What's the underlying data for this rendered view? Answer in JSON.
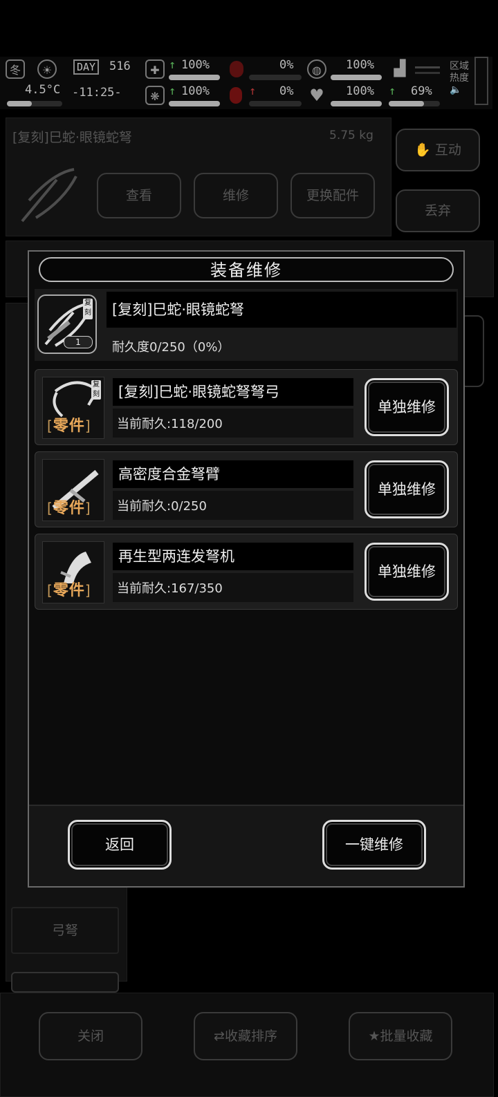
{
  "hud": {
    "season": "冬",
    "temperature": "4.5°C",
    "day_label": "DAY",
    "day_number": "516",
    "time": "-11:25-",
    "stats": [
      {
        "value": "100%"
      },
      {
        "value": "0%"
      },
      {
        "value": "100%"
      },
      {
        "value": "100%"
      },
      {
        "value": "0%"
      },
      {
        "value": "100%"
      },
      {
        "value": "69%"
      }
    ],
    "region_heat_line1": "区域",
    "region_heat_line2": "热度"
  },
  "background": {
    "item_name": "[复刻]巳蛇·眼镜蛇弩",
    "item_weight": "5.75 kg",
    "view_btn": "查看",
    "repair_btn": "维修",
    "swap_btn": "更换配件",
    "interact_btn": "互动",
    "discard_btn": "丢弃",
    "category_label": "弓弩",
    "close_btn": "关闭",
    "sort_btn": "收藏排序",
    "batch_btn": "批量收藏"
  },
  "modal": {
    "title": "装备维修",
    "item": {
      "name": "[复刻]巳蛇·眼镜蛇弩",
      "durability": "耐久度0/250（0%）",
      "count": "1",
      "badge": "复刻"
    },
    "parts": [
      {
        "name": "[复刻]巳蛇·眼镜蛇弩弩弓",
        "durability": "当前耐久:118/200",
        "tag": "零件",
        "badge": "复刻",
        "button": "单独维修"
      },
      {
        "name": "高密度合金弩臂",
        "durability": "当前耐久:0/250",
        "tag": "零件",
        "button": "单独维修"
      },
      {
        "name": "再生型两连发弩机",
        "durability": "当前耐久:167/350",
        "tag": "零件",
        "button": "单独维修"
      }
    ],
    "back_btn": "返回",
    "repair_all_btn": "一键维修"
  }
}
